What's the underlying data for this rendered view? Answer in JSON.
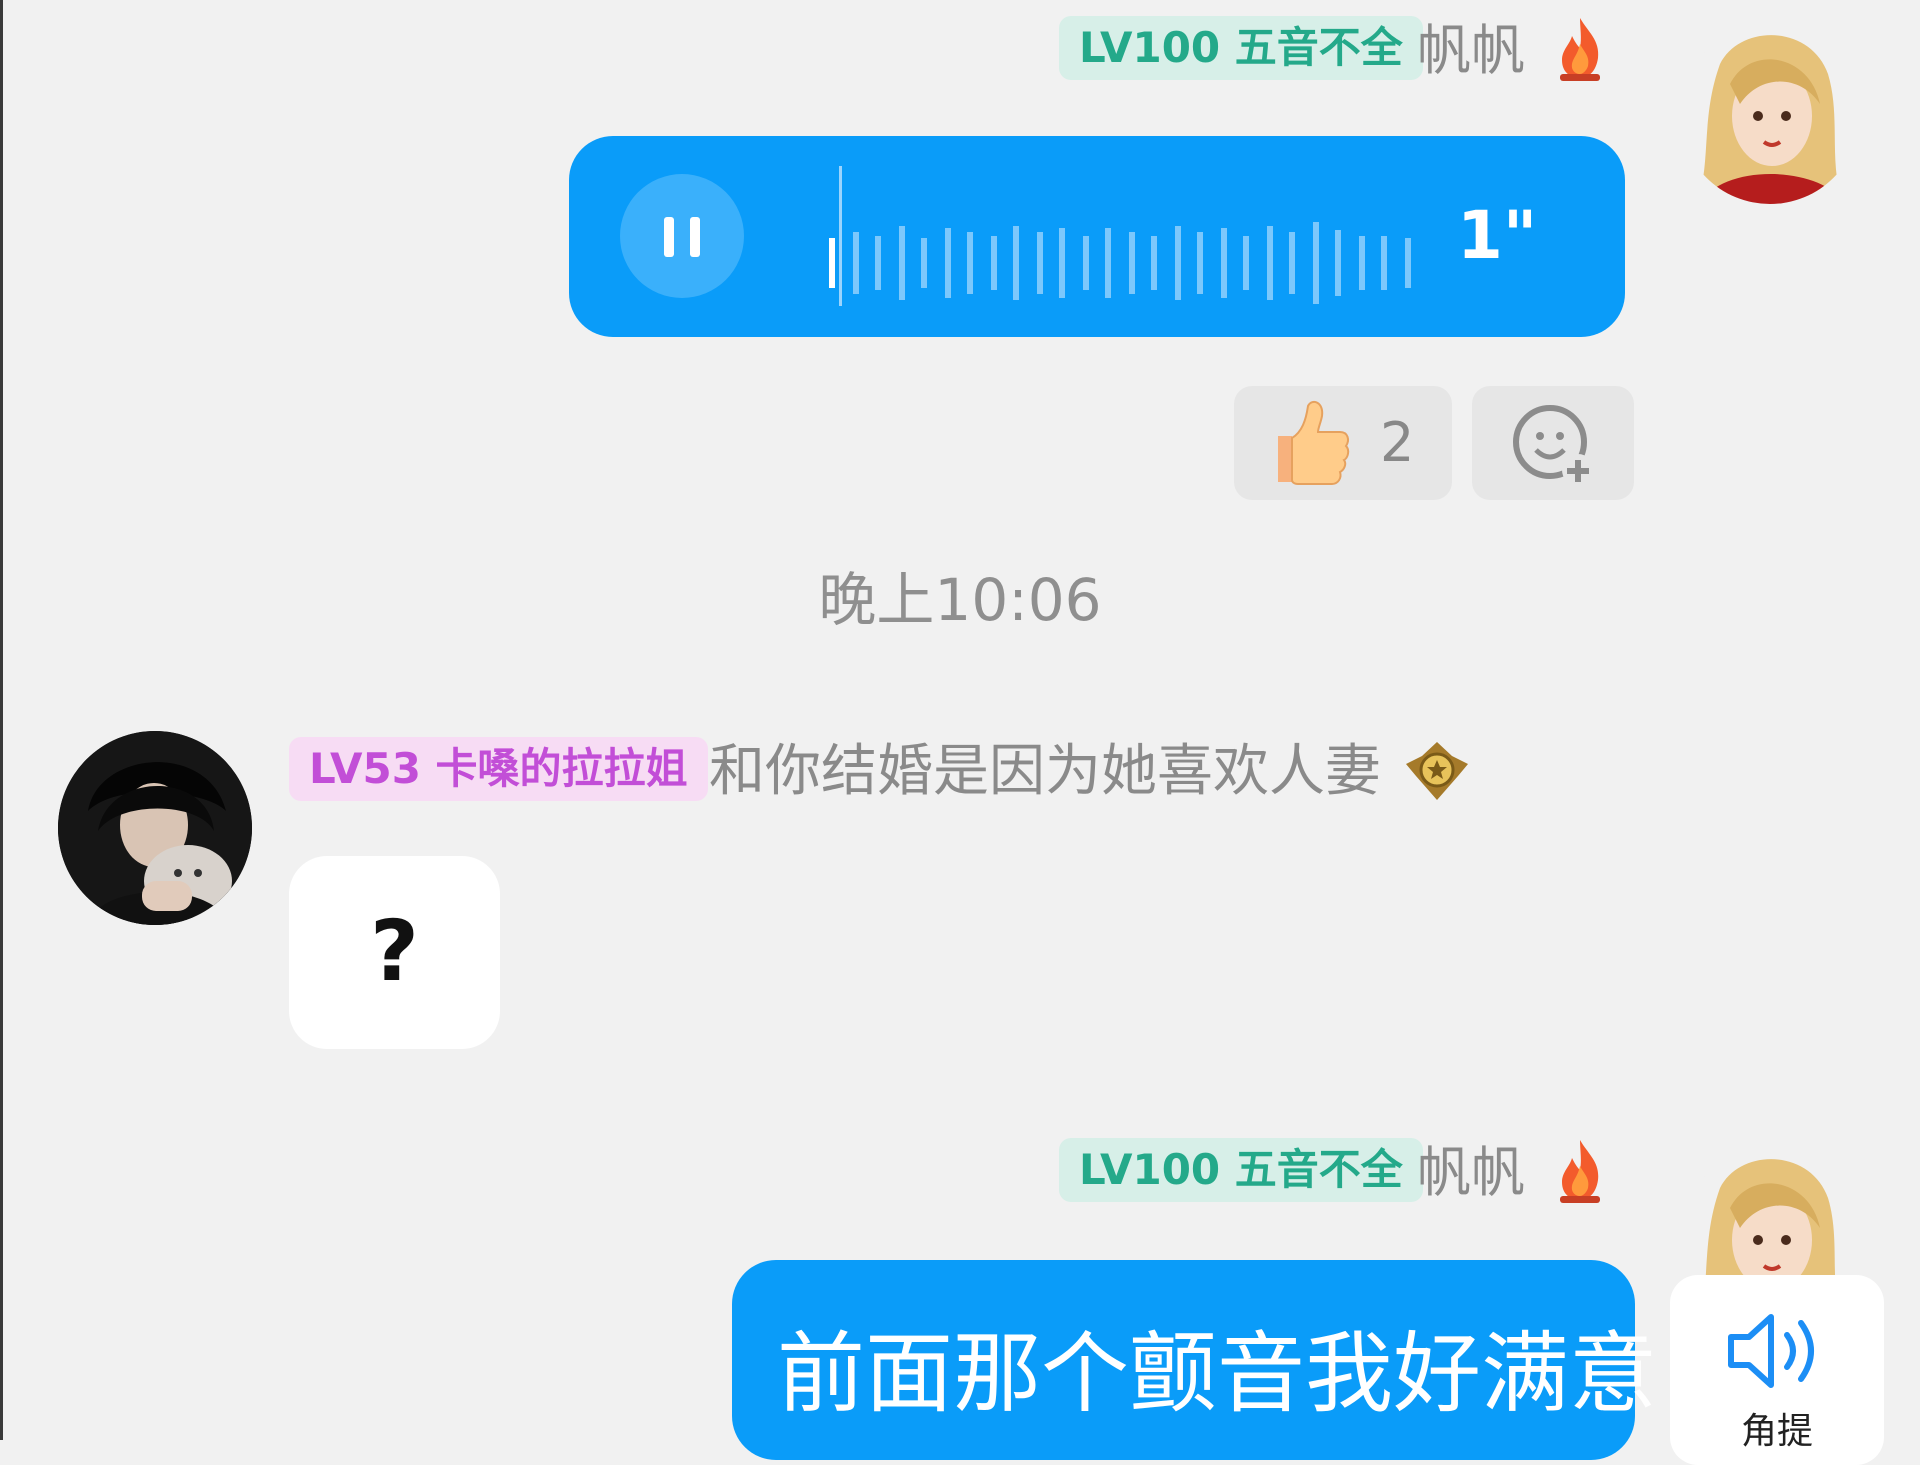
{
  "messages": {
    "first": {
      "level_tag": "LV100 五音不全",
      "nickname": "帆帆",
      "voice": {
        "duration": "1\""
      },
      "reactions": {
        "like_count": "2"
      }
    },
    "timestamp": "晚上10:06",
    "second": {
      "level_tag": "LV53 卡嗓的拉拉姐",
      "text": "和你结婚是因为她喜欢人妻",
      "bubble_text": "?"
    },
    "third": {
      "level_tag": "LV100 五音不全",
      "nickname": "帆帆",
      "bubble_text": "前面那个颤音我好满意"
    }
  },
  "tts_card": {
    "label": "角提"
  },
  "icons": {
    "fire": "fire-icon",
    "thumbs_up": "thumbs-up-icon",
    "add_emoji": "add-emoji-icon",
    "badge": "gold-badge-icon",
    "speaker": "speaker-icon",
    "pause": "pause-icon"
  },
  "colors": {
    "background": "#f1f1f1",
    "bubble_blue": "#0a9cf9",
    "tag_green_bg": "#d7efe8",
    "tag_green_fg": "#24a98a",
    "tag_pink_bg": "#f7dcf4",
    "tag_pink_fg": "#c24ed7"
  }
}
